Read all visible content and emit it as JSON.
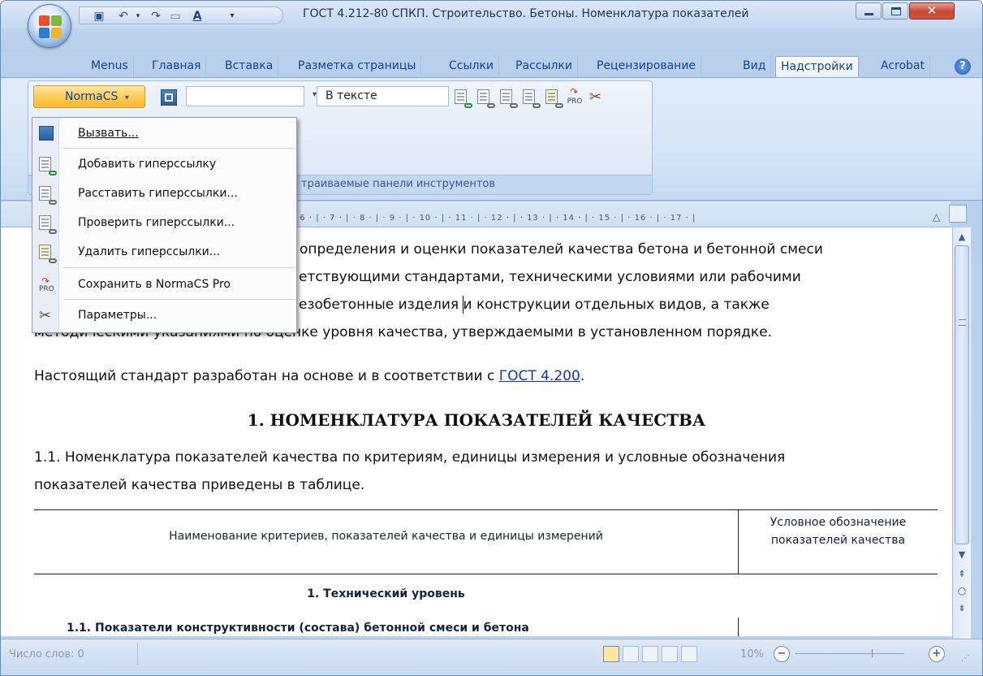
{
  "window": {
    "title": "ГОСТ 4.212-80 СПКП. Строительство. Бетоны. Номенклатура показателей"
  },
  "tabs": [
    "Menus",
    "Главная",
    "Вставка",
    "Разметка страницы",
    "Ссылки",
    "Рассылки",
    "Рецензирование",
    "Вид",
    "Надстройки",
    "Acrobat"
  ],
  "active_tab": "Надстройки",
  "ribbon": {
    "normacs_label": "NormaCS",
    "combo2_value": "В тексте",
    "group_caption": "траиваемые панели инструментов"
  },
  "ruler": {
    "scale": "· 6 · | · 7 · | · 8 · | · 9 · | · 10 · | · 11 · | · 12 · | · 13 · | · 14 · | · 15 · | · 16 · | · 17 · |"
  },
  "menu": {
    "items": [
      {
        "label": "Вызвать...",
        "icon": "normacs-call-icon"
      },
      {
        "label": "Добавить гиперссылку",
        "icon": "add-hyperlink-icon"
      },
      {
        "label": "Расставить гиперссылки...",
        "icon": "place-hyperlinks-icon"
      },
      {
        "label": "Проверить гиперссылки...",
        "icon": "check-hyperlinks-icon"
      },
      {
        "label": "Удалить гиперссылки...",
        "icon": "delete-hyperlinks-icon"
      },
      {
        "label": "Сохранить в NormaCS Pro",
        "icon": "save-pro-icon"
      },
      {
        "label": "Параметры...",
        "icon": "settings-icon"
      }
    ]
  },
  "document": {
    "line1": "определения и оценки показателей качества бетона и бетонной смеси",
    "line2": "етствующими стандартами, техническими условиями или рабочими",
    "line3": "езобетонные изделия и конструкции отдельных видов, а также",
    "line4": "методическими указаниями по оценке уровня качества, утверждаемыми в установленном порядке.",
    "para2_prefix": "Настоящий стандарт разработан на основе и в соответствии с ",
    "para2_link": "ГОСТ 4.200",
    "para2_suffix": ".",
    "heading": "1. НОМЕНКЛАТУРА ПОКАЗАТЕЛЕЙ КАЧЕСТВА",
    "para3_line1": "1.1. Номенклатура показателей качества по критериям, единицы измерения и условные обозначения",
    "para3_line2": "показателей качества приведены в таблице.",
    "table": {
      "col1_header": "Наименование критериев, показателей качества и единицы измерений",
      "col2_header": "Условное обозначение показателей качества",
      "row1": "1. Технический уровень",
      "row2": "1.1. Показатели конструктивности (состава) бетонной смеси и бетона"
    }
  },
  "status": {
    "word_count": "Число слов: 0",
    "zoom": "10%"
  }
}
